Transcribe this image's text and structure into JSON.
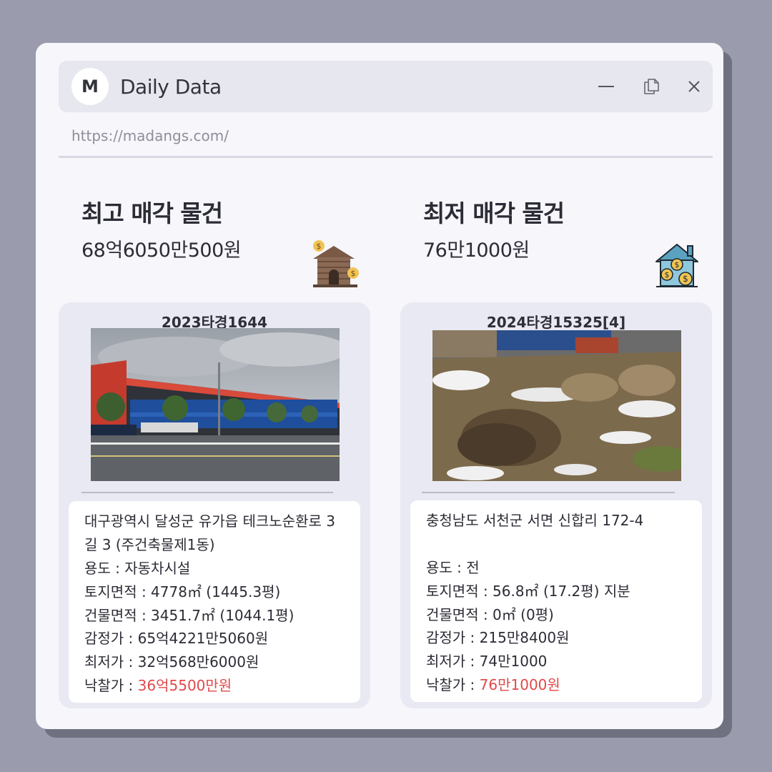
{
  "app": {
    "title": "Daily Data",
    "logo_letter": "M",
    "url": "https://madangs.com/"
  },
  "highest": {
    "heading": "최고 매각 물건",
    "price": "68억6050만500원",
    "case_no": "2023타경1644",
    "address": "대구광역시 달성군 유가읍 테크노순환로 3길 3 (주건축물제1동)",
    "usage": "용도 : 자동차시설",
    "land_area": "토지면적 : 4778㎡ (1445.3평)",
    "building_area": "건물면적 : 3451.7㎡ (1044.1평)",
    "appraisal": "감정가 : 65억4221만5060원",
    "minimum": "최저가 : 32억568만6000원",
    "winning_label": "낙찰가 : ",
    "winning_value": "36억5500만원"
  },
  "lowest": {
    "heading": "최저 매각 물건",
    "price": "76만1000원",
    "case_no": "2024타경15325[4]",
    "address": "충청남도 서천군 서면 신합리 172-4",
    "usage": "용도 : 전",
    "land_area": "토지면적 : 56.8㎡ (17.2평) 지분",
    "building_area": "건물면적 : 0㎡ (0평)",
    "appraisal": "감정가 : 215만8400원",
    "minimum": "최저가 : 74만1000",
    "winning_label": "낙찰가 : ",
    "winning_value": "76만1000원"
  },
  "colors": {
    "accent_red": "#e04949",
    "background": "#9a9bad",
    "card": "#e9e9f3"
  }
}
